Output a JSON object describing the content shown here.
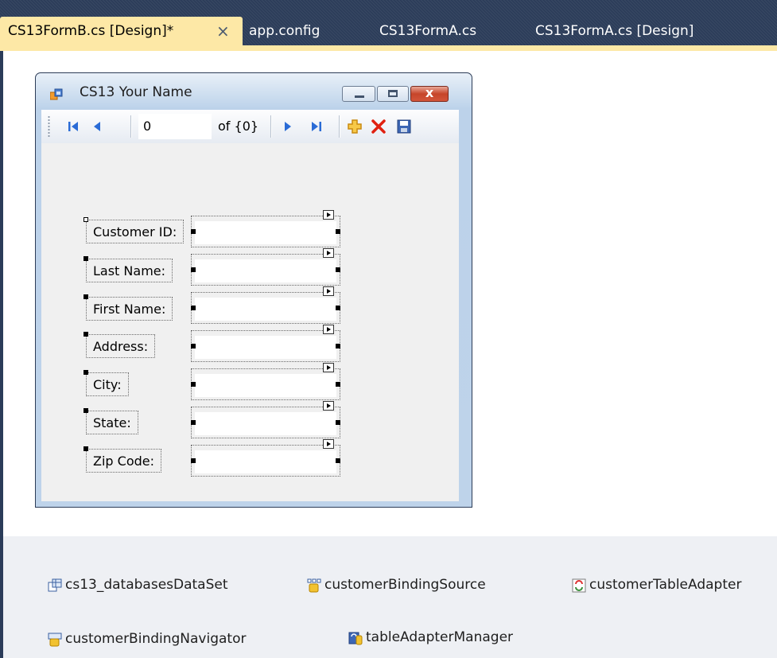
{
  "tabs": [
    {
      "label": "CS13FormB.cs [Design]*",
      "active": true,
      "close": "×"
    },
    {
      "label": "app.config"
    },
    {
      "label": "CS13FormA.cs"
    },
    {
      "label": "CS13FormA.cs [Design]"
    }
  ],
  "form": {
    "title": "CS13 Your Name",
    "close_glyph": "x"
  },
  "navigator": {
    "position": "0",
    "count": "of {0}",
    "icons": [
      "move-first-icon",
      "move-previous-icon",
      "move-next-icon",
      "move-last-icon",
      "add-new-icon",
      "delete-icon",
      "save-icon"
    ]
  },
  "fields": [
    {
      "label": "Customer ID:"
    },
    {
      "label": "Last Name:"
    },
    {
      "label": "First Name:"
    },
    {
      "label": "Address:"
    },
    {
      "label": "City:"
    },
    {
      "label": "State:"
    },
    {
      "label": "Zip Code:"
    }
  ],
  "tray": [
    {
      "label": "cs13_databasesDataSet",
      "icon": "dataset-icon"
    },
    {
      "label": "customerBindingSource",
      "icon": "binding-source-icon"
    },
    {
      "label": "customerTableAdapter",
      "icon": "table-adapter-icon"
    },
    {
      "label": "customerBindingNavigator",
      "icon": "binding-navigator-icon"
    },
    {
      "label": "tableAdapterManager",
      "icon": "table-adapter-manager-icon"
    }
  ],
  "colors": {
    "tab_background": "#2b3c59",
    "active_tab": "#fde8a6",
    "form_frame": "#bcd2ea",
    "close_button": "#c6452a",
    "delete_icon": "#e02010",
    "add_icon": "#f0b020",
    "tray_background": "#eef0f4"
  }
}
